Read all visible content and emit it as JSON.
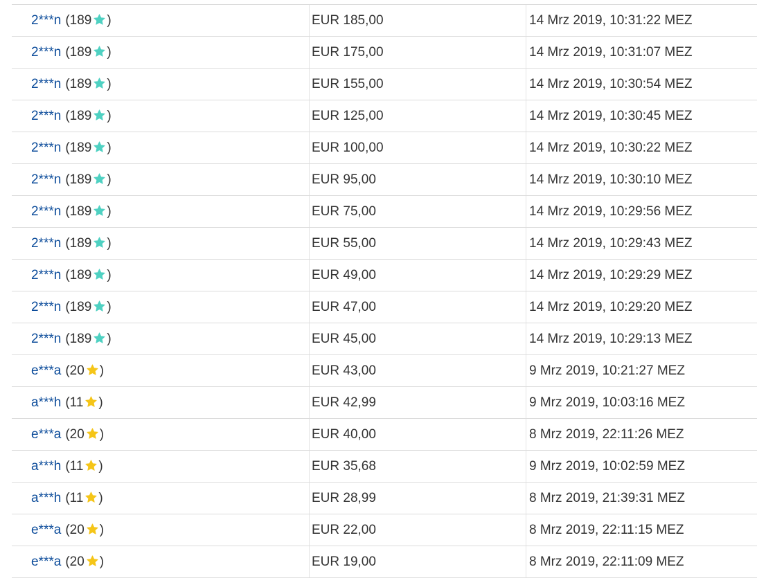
{
  "colors": {
    "link": "#0b4b9a",
    "text": "#333333",
    "divider": "#dcdcdc",
    "star_turquoise": "#4fd1c2",
    "star_yellow": "#f5c518"
  },
  "bids": [
    {
      "bidder": "2***n",
      "score": "189",
      "star": "turquoise-star-icon",
      "amount": "EUR 185,00",
      "time": "14 Mrz 2019, 10:31:22 MEZ"
    },
    {
      "bidder": "2***n",
      "score": "189",
      "star": "turquoise-star-icon",
      "amount": "EUR 175,00",
      "time": "14 Mrz 2019, 10:31:07 MEZ"
    },
    {
      "bidder": "2***n",
      "score": "189",
      "star": "turquoise-star-icon",
      "amount": "EUR 155,00",
      "time": "14 Mrz 2019, 10:30:54 MEZ"
    },
    {
      "bidder": "2***n",
      "score": "189",
      "star": "turquoise-star-icon",
      "amount": "EUR 125,00",
      "time": "14 Mrz 2019, 10:30:45 MEZ"
    },
    {
      "bidder": "2***n",
      "score": "189",
      "star": "turquoise-star-icon",
      "amount": "EUR 100,00",
      "time": "14 Mrz 2019, 10:30:22 MEZ"
    },
    {
      "bidder": "2***n",
      "score": "189",
      "star": "turquoise-star-icon",
      "amount": "EUR 95,00",
      "time": "14 Mrz 2019, 10:30:10 MEZ"
    },
    {
      "bidder": "2***n",
      "score": "189",
      "star": "turquoise-star-icon",
      "amount": "EUR 75,00",
      "time": "14 Mrz 2019, 10:29:56 MEZ"
    },
    {
      "bidder": "2***n",
      "score": "189",
      "star": "turquoise-star-icon",
      "amount": "EUR 55,00",
      "time": "14 Mrz 2019, 10:29:43 MEZ"
    },
    {
      "bidder": "2***n",
      "score": "189",
      "star": "turquoise-star-icon",
      "amount": "EUR 49,00",
      "time": "14 Mrz 2019, 10:29:29 MEZ"
    },
    {
      "bidder": "2***n",
      "score": "189",
      "star": "turquoise-star-icon",
      "amount": "EUR 47,00",
      "time": "14 Mrz 2019, 10:29:20 MEZ"
    },
    {
      "bidder": "2***n",
      "score": "189",
      "star": "turquoise-star-icon",
      "amount": "EUR 45,00",
      "time": "14 Mrz 2019, 10:29:13 MEZ"
    },
    {
      "bidder": "e***a",
      "score": "20",
      "star": "yellow-star-icon",
      "amount": "EUR 43,00",
      "time": "9 Mrz 2019, 10:21:27 MEZ"
    },
    {
      "bidder": "a***h",
      "score": "11",
      "star": "yellow-star-icon",
      "amount": "EUR 42,99",
      "time": "9 Mrz 2019, 10:03:16 MEZ"
    },
    {
      "bidder": "e***a",
      "score": "20",
      "star": "yellow-star-icon",
      "amount": "EUR 40,00",
      "time": "8 Mrz 2019, 22:11:26 MEZ"
    },
    {
      "bidder": "a***h",
      "score": "11",
      "star": "yellow-star-icon",
      "amount": "EUR 35,68",
      "time": "9 Mrz 2019, 10:02:59 MEZ"
    },
    {
      "bidder": "a***h",
      "score": "11",
      "star": "yellow-star-icon",
      "amount": "EUR 28,99",
      "time": "8 Mrz 2019, 21:39:31 MEZ"
    },
    {
      "bidder": "e***a",
      "score": "20",
      "star": "yellow-star-icon",
      "amount": "EUR 22,00",
      "time": "8 Mrz 2019, 22:11:15 MEZ"
    },
    {
      "bidder": "e***a",
      "score": "20",
      "star": "yellow-star-icon",
      "amount": "EUR 19,00",
      "time": "8 Mrz 2019, 22:11:09 MEZ"
    }
  ]
}
